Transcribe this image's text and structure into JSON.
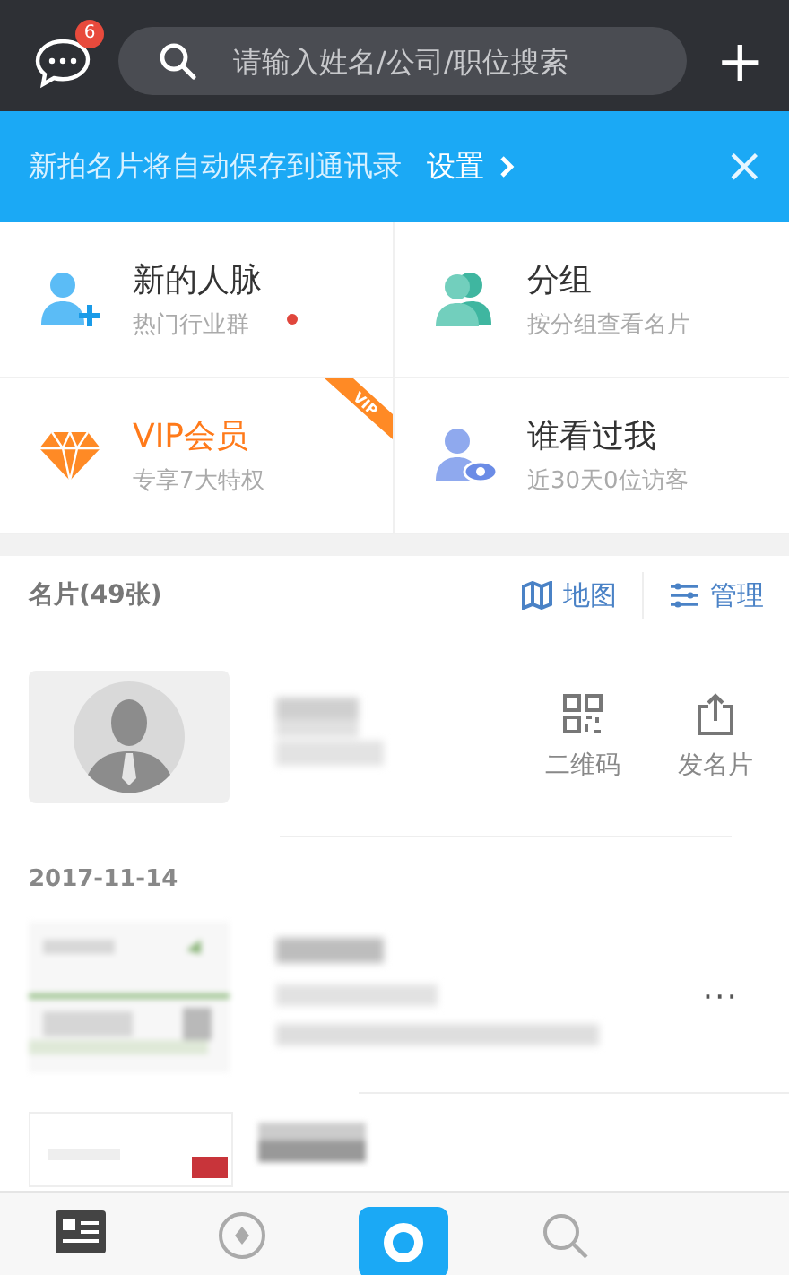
{
  "top_bar": {
    "message_badge": "6",
    "search": {
      "placeholder": "请输入姓名/公司/职位搜索"
    },
    "add": "+"
  },
  "banner": {
    "text": "新拍名片将自动保存到通讯录",
    "link": "设置",
    "close": "×"
  },
  "shortcuts": [
    {
      "kind": "add-person",
      "title": "新的人脉",
      "subtitle": "热门行业群",
      "dot": true,
      "vip": false,
      "highlight": false
    },
    {
      "kind": "group",
      "title": "分组",
      "subtitle": "按分组查看名片",
      "dot": false,
      "vip": false,
      "highlight": false
    },
    {
      "kind": "diamond",
      "title": "VIP会员",
      "subtitle": "专享7大特权",
      "dot": false,
      "vip": true,
      "highlight": true
    },
    {
      "kind": "viewer",
      "title": "谁看过我",
      "subtitle": "近30天0位访客",
      "dot": false,
      "vip": false,
      "highlight": false
    }
  ],
  "vip_ribbon": "VIP",
  "cards_header": {
    "title": "名片(49张)",
    "actions": [
      {
        "kind": "map",
        "label": "地图"
      },
      {
        "kind": "manage",
        "label": "管理"
      }
    ]
  },
  "my_card": {
    "actions": [
      {
        "kind": "qr",
        "label": "二维码"
      },
      {
        "kind": "share",
        "label": "发名片"
      }
    ]
  },
  "date": "2017-11-14",
  "more": "···",
  "bottom_nav": [
    {
      "kind": "cards",
      "selected": true
    },
    {
      "kind": "compass",
      "selected": false
    },
    {
      "kind": "camera",
      "selected": false
    },
    {
      "kind": "search",
      "selected": false
    }
  ]
}
